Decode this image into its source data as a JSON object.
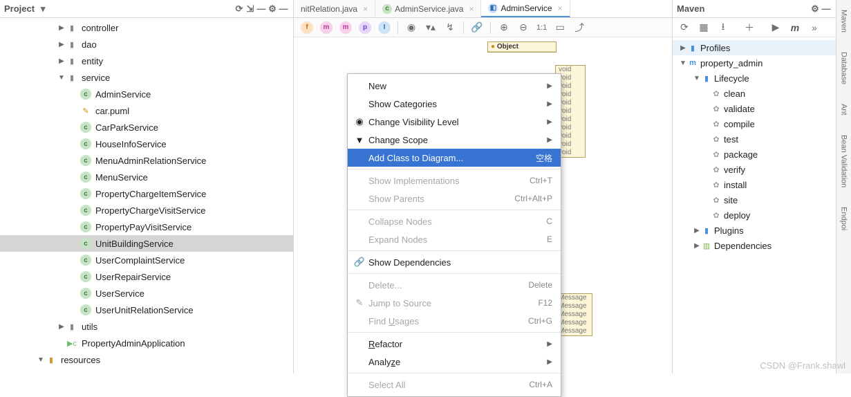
{
  "project_panel": {
    "title": "Project",
    "tree": {
      "controller": "controller",
      "dao": "dao",
      "entity": "entity",
      "service": "service",
      "service_items": [
        "AdminService",
        "car.puml",
        "CarParkService",
        "HouseInfoService",
        "MenuAdminRelationService",
        "MenuService",
        "PropertyChargeItemService",
        "PropertyChargeVisitService",
        "PropertyPayVisitService",
        "UnitBuildingService",
        "UserComplaintService",
        "UserRepairService",
        "UserService",
        "UserUnitRelationService"
      ],
      "utils": "utils",
      "app": "PropertyAdminApplication",
      "resources": "resources"
    }
  },
  "editor": {
    "tabs": {
      "t1": "nitRelation.java",
      "t2": "AdminService.java",
      "t3": "AdminService"
    },
    "toolbar_letters": {
      "f": "f",
      "m1": "m",
      "m2": "m",
      "p": "p",
      "i": "I"
    },
    "toolbar_zoom_label": "1:1",
    "uml": {
      "object": "Object",
      "row_void": "void",
      "row_msg": "Message"
    }
  },
  "context_menu": {
    "new": "New",
    "show_categories": "Show Categories",
    "change_visibility": "Change Visibility Level",
    "change_scope": "Change Scope",
    "add_class": "Add Class to Diagram...",
    "add_class_sc": "空格",
    "show_impl": "Show Implementations",
    "show_impl_sc": "Ctrl+T",
    "show_parents": "Show Parents",
    "show_parents_sc": "Ctrl+Alt+P",
    "collapse": "Collapse Nodes",
    "collapse_sc": "C",
    "expand": "Expand Nodes",
    "expand_sc": "E",
    "show_deps": "Show Dependencies",
    "delete": "Delete...",
    "delete_sc": "Delete",
    "jump": "Jump to Source",
    "jump_sc": "F12",
    "find_usages_pre": "Find ",
    "find_usages_u": "U",
    "find_usages_post": "sages",
    "find_sc": "Ctrl+G",
    "refactor_u": "R",
    "refactor_rest": "efactor",
    "analyze_pre": "Analy",
    "analyze_u": "z",
    "analyze_post": "e",
    "select_all": "Select All",
    "select_all_sc": "Ctrl+A"
  },
  "maven": {
    "title": "Maven",
    "profiles": "Profiles",
    "project": "property_admin",
    "lifecycle": "Lifecycle",
    "phases": [
      "clean",
      "validate",
      "compile",
      "test",
      "package",
      "verify",
      "install",
      "site",
      "deploy"
    ],
    "plugins": "Plugins",
    "dependencies": "Dependencies"
  },
  "side_tabs": {
    "t1": "Maven",
    "t2": "Database",
    "t3": "Ant",
    "t4": "Bean Validation",
    "t5": "Endpoi"
  },
  "watermark": "CSDN @Frank.shawl"
}
